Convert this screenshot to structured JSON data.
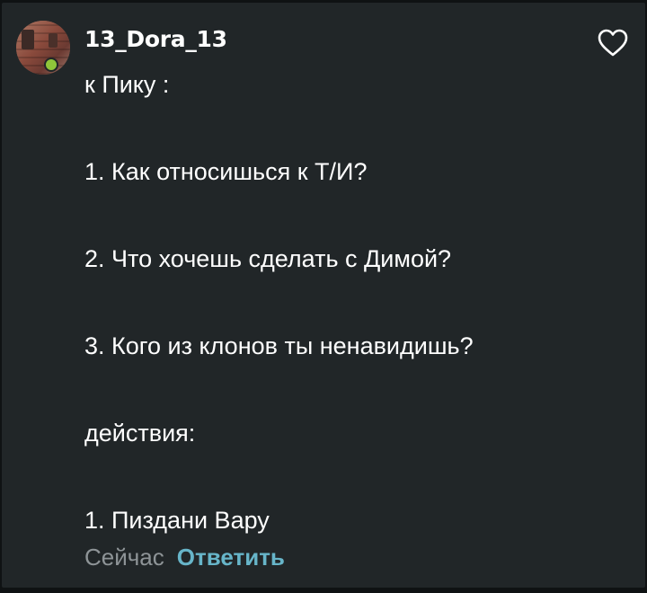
{
  "comment": {
    "username": "13_Dora_13",
    "lines": [
      "к Пику :",
      "1. Как относишься к Т/И?",
      "2. Что хочешь сделать с Димой?",
      "3. Кого из клонов ты ненавидишь?",
      "действия:",
      "1. Пиздани Вару"
    ],
    "time": "Сейчас",
    "reply_label": "Ответить",
    "like_icon": "heart-outline-icon"
  },
  "colors": {
    "background": "#212628",
    "text": "#ffffff",
    "muted": "#8e9497",
    "accent": "#67b5c9"
  }
}
